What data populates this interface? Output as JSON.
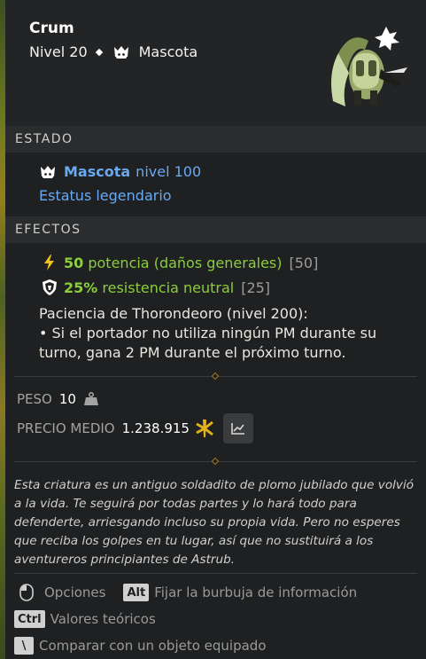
{
  "item": {
    "name": "Crum",
    "level_label": "Nivel 20",
    "type_label": "Mascota"
  },
  "sections": {
    "status_title": "ESTADO",
    "effects_title": "EFECTOS"
  },
  "status": {
    "type_bold": "Mascota",
    "level": "nivel 100",
    "legendary": "Estatus legendario"
  },
  "effects": [
    {
      "value": "50",
      "text": "potencia (daños generales)",
      "theoretical": "[50]",
      "icon": "lightning-icon"
    },
    {
      "value": "25%",
      "text": "resistencia neutral",
      "theoretical": "[25]",
      "icon": "neutral-shield-icon"
    }
  ],
  "special_effect": {
    "title": "Paciencia de Thorondeoro (nivel 200):",
    "body": "• Si el portador no utiliza ningún PM durante su turno, gana 2 PM durante el próximo turno."
  },
  "weight": {
    "label": "PESO",
    "value": "10"
  },
  "price": {
    "label": "PRECIO MEDIO",
    "value": "1.238.915"
  },
  "lore": "Esta criatura es un antiguo soldadito de plomo jubilado que volvió a la vida. Te seguirá por todas partes y lo hará todo para defenderte, arriesgando incluso su propia vida. Pero no esperes que reciba los golpes en tu lugar, así que no sustituirá a los aventureros principiantes de Astrub.",
  "hints": {
    "options": "Opciones",
    "alt_key": "Alt",
    "pin": "Fijar la burbuja de información",
    "ctrl_key": "Ctrl",
    "theoretical": "Valores teóricos",
    "compare_key": "\\",
    "compare": "Comparar con un objeto equipado"
  },
  "colors": {
    "accent_blue": "#69a9f2",
    "effect_green": "#8bcf3a",
    "kama_gold": "#e2b21f"
  }
}
